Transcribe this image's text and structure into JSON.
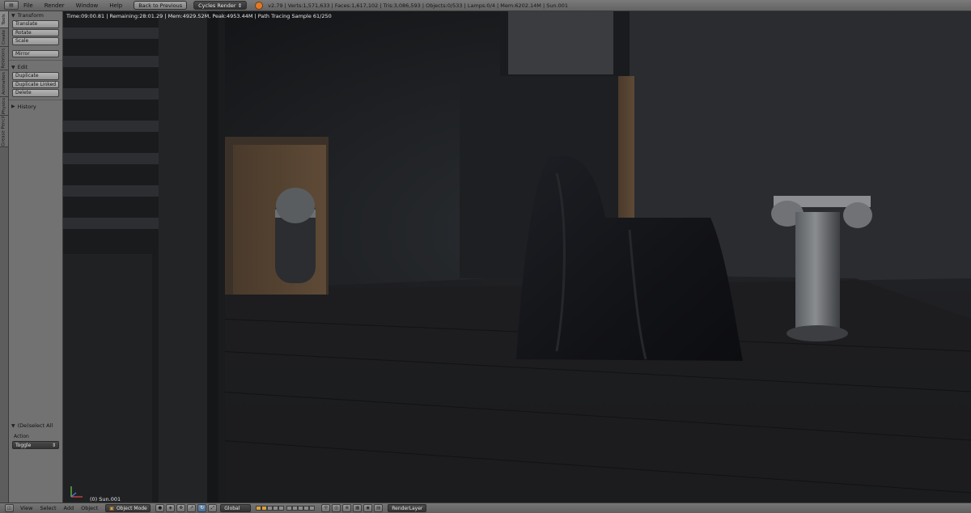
{
  "top_header": {
    "menus": [
      "File",
      "Render",
      "Window",
      "Help"
    ],
    "back_button": "Back to Previous",
    "render_engine": "Cycles Render",
    "stats": "v2.79 | Verts:1,571,633 | Faces:1,617,102 | Tris:3,086,593 | Objects:0/533 | Lamps:0/4 | Mem:6202.14M | Sun.001"
  },
  "tool_tabs": [
    "Tools",
    "Create",
    "Relations",
    "Animation",
    "Physics",
    "Grease Pencil"
  ],
  "toolshelf": {
    "transform": {
      "title": "Transform",
      "buttons": [
        "Translate",
        "Rotate",
        "Scale",
        "Mirror"
      ]
    },
    "edit": {
      "title": "Edit",
      "buttons": [
        "Duplicate",
        "Duplicate Linked",
        "Delete"
      ]
    },
    "history": {
      "title": "History"
    }
  },
  "redo_panel": {
    "title": "(De)select All",
    "action_label": "Action",
    "action_value": "Toggle"
  },
  "viewport": {
    "render_info": "Time:09:00.81 | Remaining:28:01.29 | Mem:4929.52M, Peak:4953.44M | Path Tracing Sample 61/250",
    "object_label": "(0) Sun.001"
  },
  "bottom_header": {
    "menus": [
      "View",
      "Select",
      "Add",
      "Object"
    ],
    "mode": "Object Mode",
    "orientation": "Global",
    "render_layer": "RenderLayer"
  }
}
